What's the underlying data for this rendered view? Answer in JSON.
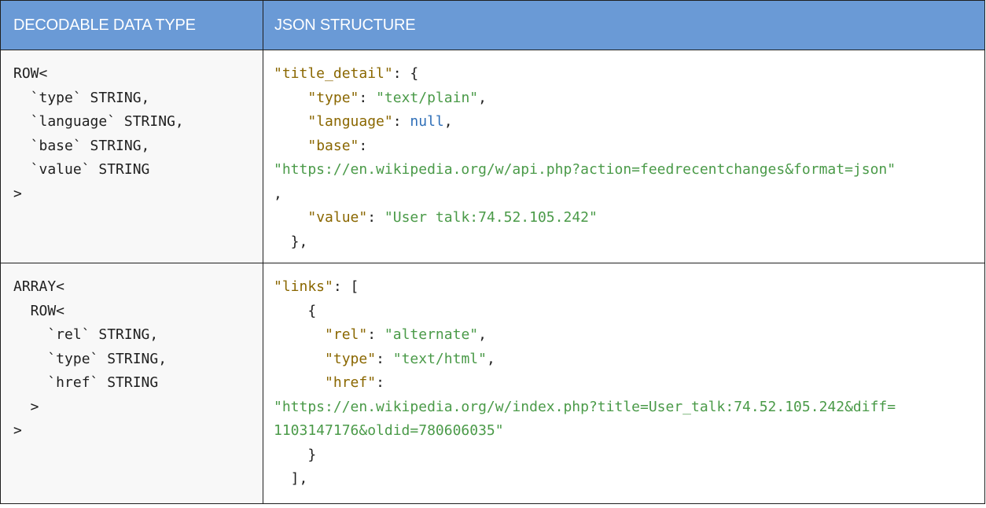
{
  "table": {
    "headers": [
      "DECODABLE DATA TYPE",
      "JSON STRUCTURE"
    ],
    "rows": [
      {
        "type_lines": [
          "ROW<",
          "  `type` STRING,",
          "  `language` STRING,",
          "  `base` STRING,",
          "  `value` STRING",
          ">"
        ],
        "json_tokens": {
          "k_title_detail": "\"title_detail\"",
          "k_type": "\"type\"",
          "v_type": "\"text/plain\"",
          "k_language": "\"language\"",
          "v_language": "null",
          "k_base": "\"base\"",
          "v_base": "\"https://en.wikipedia.org/w/api.php?action=feedrecentchanges&format=json\"",
          "k_value": "\"value\"",
          "v_value": "\"User talk:74.52.105.242\""
        }
      },
      {
        "type_lines": [
          "ARRAY<",
          "  ROW<",
          "    `rel` STRING,",
          "    `type` STRING,",
          "    `href` STRING",
          "  >",
          ">"
        ],
        "json_tokens": {
          "k_links": "\"links\"",
          "k_rel": "\"rel\"",
          "v_rel": "\"alternate\"",
          "k_type": "\"type\"",
          "v_type": "\"text/html\"",
          "k_href": "\"href\"",
          "v_href_1": "\"https://en.wikipedia.org/w/index.php?title=User_talk:74.52.105.242&diff=",
          "v_href_2": "1103147176&oldid=780606035\""
        }
      }
    ]
  },
  "colors": {
    "header_bg": "#6a9ad6",
    "key": "#8a6700",
    "string": "#4a9a48",
    "literal": "#2f6fb8"
  }
}
